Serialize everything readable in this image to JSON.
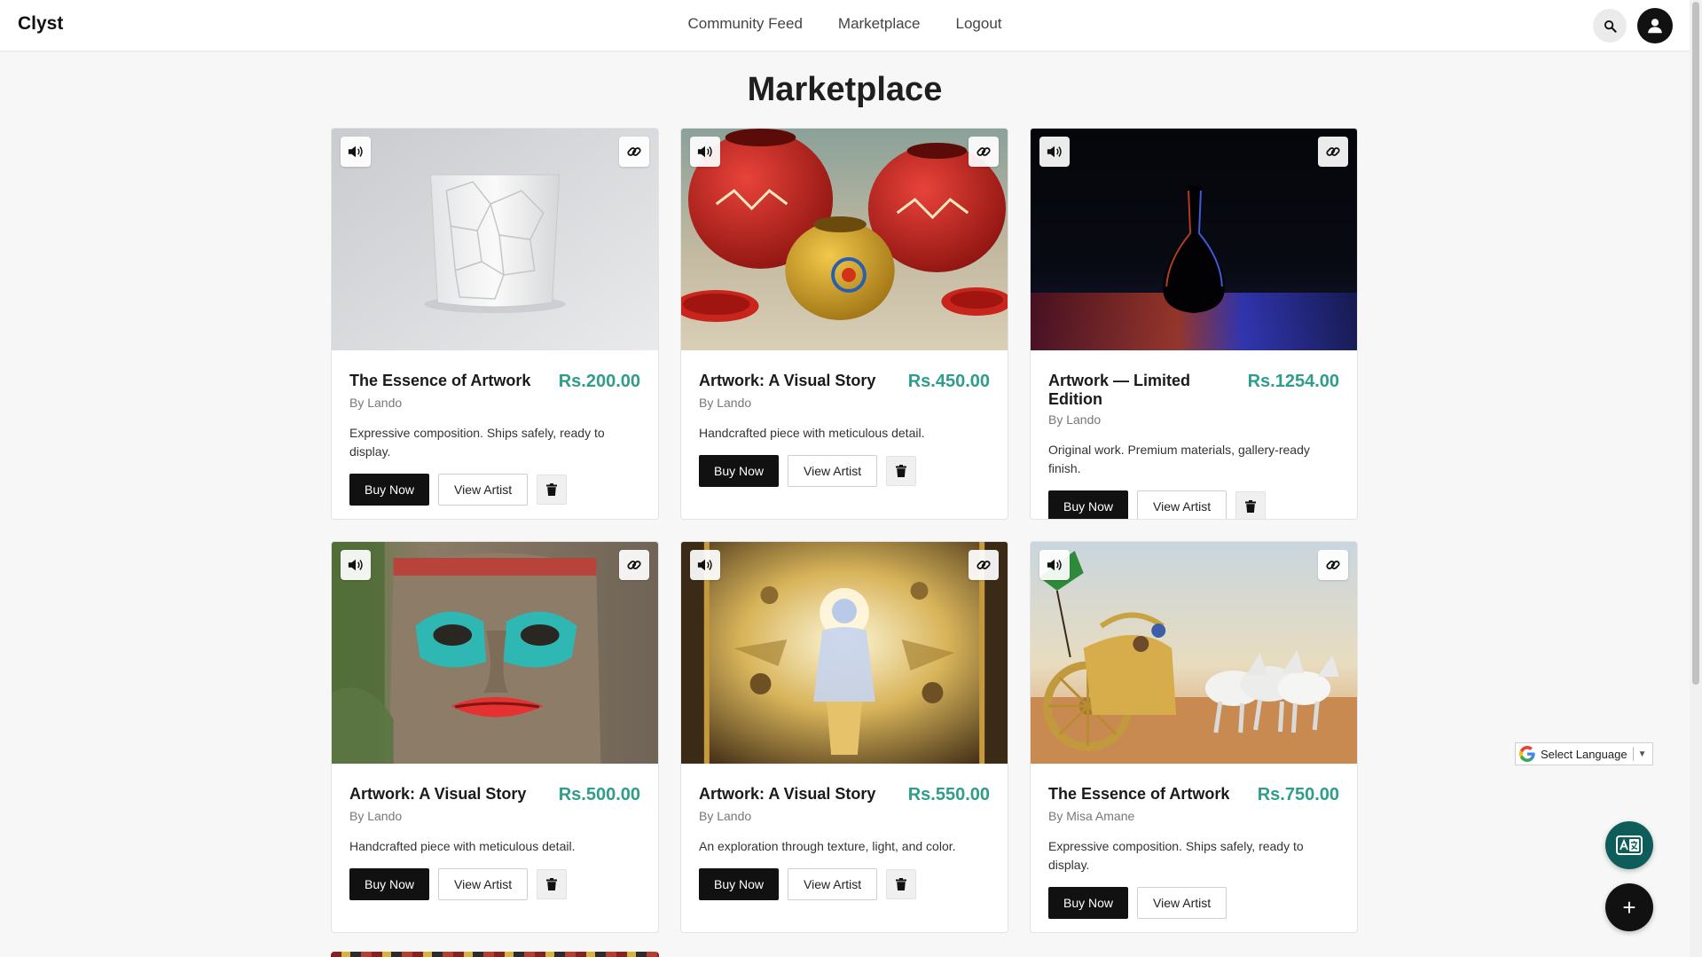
{
  "brand": "Clyst",
  "nav": {
    "links": [
      "Community Feed",
      "Marketplace",
      "Logout"
    ],
    "search_icon": "search-icon",
    "account_icon": "user-icon"
  },
  "page": {
    "title": "Marketplace"
  },
  "listings": [
    {
      "title": "The Essence of Artwork",
      "price": "Rs.200.00",
      "artist": "By Lando",
      "description": "Expressive composition. Ships safely, ready to display.",
      "buy_label": "Buy Now",
      "view_artist_label": "View Artist",
      "has_delete": true,
      "image": "white faceted ceramic cup"
    },
    {
      "title": "Artwork: A Visual Story",
      "price": "Rs.450.00",
      "artist": "By Lando",
      "description": "Handcrafted piece with meticulous detail.",
      "buy_label": "Buy Now",
      "view_artist_label": "View Artist",
      "has_delete": true,
      "image": "painted red clay pots"
    },
    {
      "title": "Artwork — Limited Edition",
      "price": "Rs.1254.00",
      "artist": "By Lando",
      "description": "Original work. Premium materials, gallery-ready finish.",
      "buy_label": "Buy Now",
      "view_artist_label": "View Artist",
      "has_delete": true,
      "image": "dark vase with colored light"
    },
    {
      "title": "Artwork: A Visual Story",
      "price": "Rs.500.00",
      "artist": "By Lando",
      "description": "Handcrafted piece with meticulous detail.",
      "buy_label": "Buy Now",
      "view_artist_label": "View Artist",
      "has_delete": true,
      "image": "carved wooden totem face"
    },
    {
      "title": "Artwork: A Visual Story",
      "price": "Rs.550.00",
      "artist": "By Lando",
      "description": "An exploration through texture, light, and color.",
      "buy_label": "Buy Now",
      "view_artist_label": "View Artist",
      "has_delete": true,
      "image": "golden mythological painting"
    },
    {
      "title": "The Essence of Artwork",
      "price": "Rs.750.00",
      "artist": "By Misa Amane",
      "description": "Expressive composition. Ships safely, ready to display.",
      "buy_label": "Buy Now",
      "view_artist_label": "View Artist",
      "has_delete": false,
      "image": "golden chariot with white horses"
    }
  ],
  "card_icons": {
    "audio": "speaker-icon",
    "link": "link-icon",
    "delete": "trash-icon"
  },
  "language_selector": {
    "label": "Select Language",
    "caret": "▼"
  },
  "fabs": {
    "translate_icon": "translate-icon",
    "add_icon": "plus-icon",
    "add_glyph": "+"
  },
  "colors": {
    "price": "#2f9d8a",
    "primary_button": "#111111",
    "translate_fab": "#0f5d5a"
  }
}
